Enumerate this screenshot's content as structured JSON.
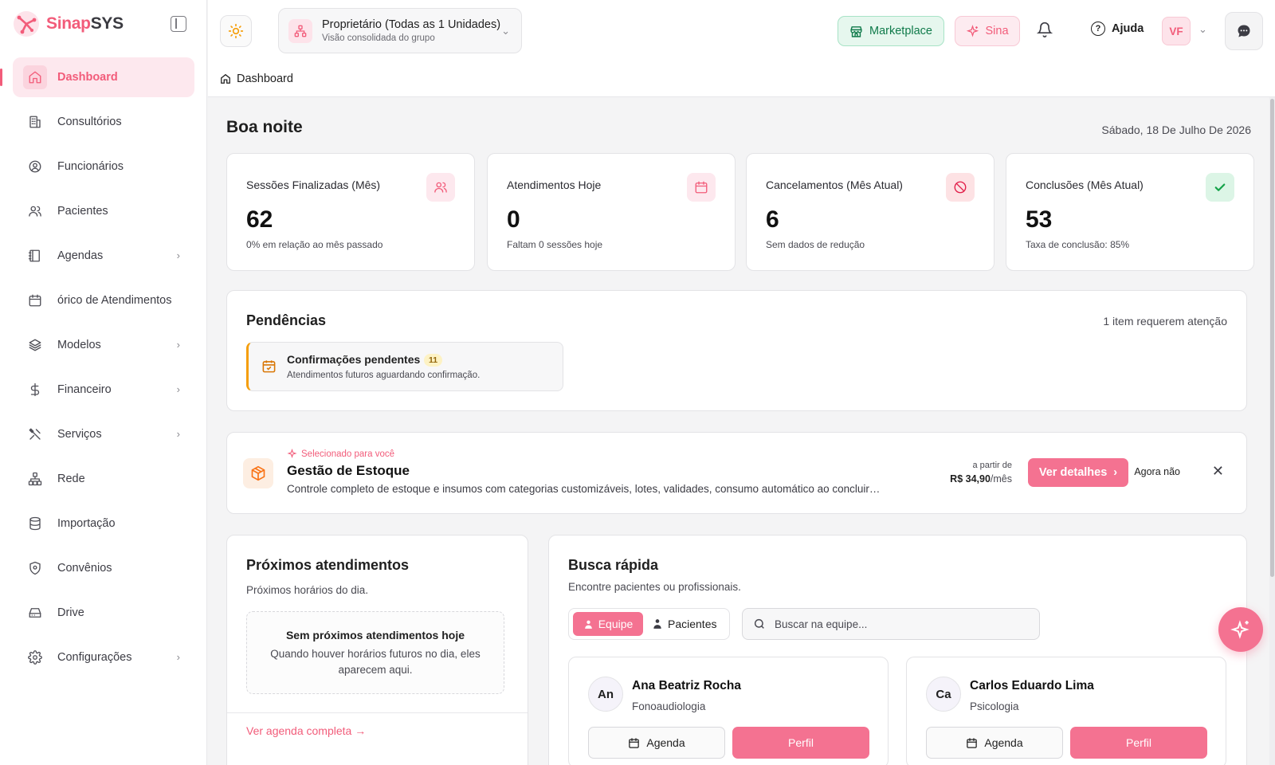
{
  "brand": {
    "name_accent": "Sinap",
    "name_rest": "SYS"
  },
  "sidebar": {
    "items": [
      {
        "label": "Dashboard",
        "icon": "home-icon",
        "active": true,
        "chevron": false
      },
      {
        "label": "Consultórios",
        "icon": "building-icon",
        "chevron": false
      },
      {
        "label": "Funcionários",
        "icon": "user-circle-icon",
        "chevron": false
      },
      {
        "label": "Pacientes",
        "icon": "users-icon",
        "chevron": false
      },
      {
        "label": "Agendas",
        "icon": "book-icon",
        "chevron": true
      },
      {
        "label": "órico de Atendimentos",
        "icon": "calendar-icon",
        "chevron": false
      },
      {
        "label": "Modelos",
        "icon": "layers-icon",
        "chevron": true
      },
      {
        "label": "Financeiro",
        "icon": "dollar-icon",
        "chevron": true
      },
      {
        "label": "Serviços",
        "icon": "tools-icon",
        "chevron": true
      },
      {
        "label": "Rede",
        "icon": "network-icon",
        "chevron": false
      },
      {
        "label": "Importação",
        "icon": "database-icon",
        "chevron": false
      },
      {
        "label": "Convênios",
        "icon": "shield-icon",
        "chevron": false
      },
      {
        "label": "Drive",
        "icon": "drive-icon",
        "chevron": false
      },
      {
        "label": "Configurações",
        "icon": "gear-icon",
        "chevron": true
      }
    ]
  },
  "topbar": {
    "unit_title": "Proprietário (Todas as 1 Unidades)",
    "unit_subtitle": "Visão consolidada do grupo",
    "marketplace_label": "Marketplace",
    "sina_label": "Sina",
    "help_label": "Ajuda",
    "avatar_initials": "VF"
  },
  "breadcrumb": {
    "current": "Dashboard"
  },
  "greeting": "Boa noite",
  "date": "Sábado, 18 De Julho De 2026",
  "stats": [
    {
      "label": "Sessões Finalizadas (Mês)",
      "value": "62",
      "sub": "0% em relação ao mês passado",
      "icon": "users-icon",
      "color": "#f25c7a",
      "bg": "#fde8ee"
    },
    {
      "label": "Atendimentos Hoje",
      "value": "0",
      "sub": "Faltam 0 sessões hoje",
      "icon": "calendar-icon",
      "color": "#f25c7a",
      "bg": "#fde8ee"
    },
    {
      "label": "Cancelamentos (Mês Atual)",
      "value": "6",
      "sub": "Sem dados de redução",
      "icon": "ban-icon",
      "color": "#e11d48",
      "bg": "#fde2e4"
    },
    {
      "label": "Conclusões (Mês Atual)",
      "value": "53",
      "sub": "Taxa de conclusão: 85%",
      "icon": "check-icon",
      "color": "#16a34a",
      "bg": "#dcf5e6"
    }
  ],
  "pendencias": {
    "title": "Pendências",
    "count_text": "1 item requerem atenção",
    "item_title": "Confirmações pendentes",
    "item_badge": "11",
    "item_sub": "Atendimentos futuros aguardando confirmação."
  },
  "promo": {
    "tag": "Selecionado para você",
    "title": "Gestão de Estoque",
    "description": "Controle completo de estoque e insumos com categorias customizáveis, lotes, validades, consumo automático ao concluir…",
    "price_label": "a partir de",
    "price": "R$ 34,90",
    "price_unit": "/mês",
    "details_label": "Ver detalhes",
    "dismiss_label": "Agora não"
  },
  "proximos": {
    "title": "Próximos atendimentos",
    "subtitle": "Próximos horários do dia.",
    "empty_title": "Sem próximos atendimentos hoje",
    "empty_desc": "Quando houver horários futuros no dia, eles aparecem aqui.",
    "link": "Ver agenda completa"
  },
  "busca": {
    "title": "Busca rápida",
    "subtitle": "Encontre pacientes ou profissionais.",
    "tab_team": "Equipe",
    "tab_patients": "Pacientes",
    "search_placeholder": "Buscar na equipe...",
    "professionals": [
      {
        "initials": "An",
        "name": "Ana Beatriz Rocha",
        "specialty": "Fonoaudiologia",
        "agenda_label": "Agenda",
        "profile_label": "Perfil"
      },
      {
        "initials": "Ca",
        "name": "Carlos Eduardo Lima",
        "specialty": "Psicologia",
        "agenda_label": "Agenda",
        "profile_label": "Perfil"
      }
    ]
  }
}
